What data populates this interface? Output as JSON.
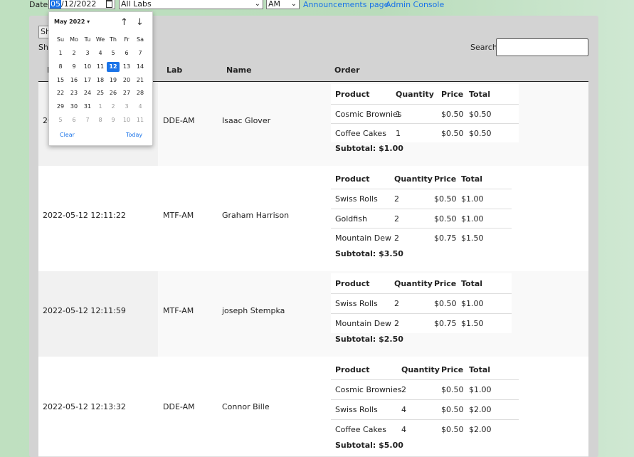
{
  "topbar": {
    "date_label": "Date:",
    "date_month_segment": "05",
    "date_rest": "/12/2022",
    "lab_select": "All Labs",
    "period_select": "AM",
    "links": [
      "Announcements page",
      "Admin Console"
    ]
  },
  "controls": {
    "show_button": "Sh",
    "show_text": "Sho",
    "search_label": "Search:"
  },
  "table": {
    "headers": {
      "date_partial": "I",
      "lab": "Lab",
      "name": "Name",
      "order": "Order"
    },
    "order_headers": [
      "Product",
      "Quantity",
      "Price",
      "Total"
    ],
    "rows": [
      {
        "date": "20",
        "lab": "DDE-AM",
        "name": "Isaac Glover",
        "items": [
          [
            "Cosmic Brownies",
            "1",
            "$0.50",
            "$0.50"
          ],
          [
            "Coffee Cakes",
            "1",
            "$0.50",
            "$0.50"
          ]
        ],
        "subtotal": "Subtotal: $1.00"
      },
      {
        "date": "2022-05-12 12:11:22",
        "lab": "MTF-AM",
        "name": "Graham Harrison",
        "items": [
          [
            "Swiss Rolls",
            "2",
            "$0.50",
            "$1.00"
          ],
          [
            "Goldfish",
            "2",
            "$0.50",
            "$1.00"
          ],
          [
            "Mountain Dew",
            "2",
            "$0.75",
            "$1.50"
          ]
        ],
        "subtotal": "Subtotal: $3.50"
      },
      {
        "date": "2022-05-12 12:11:59",
        "lab": "MTF-AM",
        "name": "joseph Stempka",
        "items": [
          [
            "Swiss Rolls",
            "2",
            "$0.50",
            "$1.00"
          ],
          [
            "Mountain Dew",
            "2",
            "$0.75",
            "$1.50"
          ]
        ],
        "subtotal": "Subtotal: $2.50"
      },
      {
        "date": "2022-05-12 12:13:32",
        "lab": "DDE-AM",
        "name": "Connor Bille",
        "items": [
          [
            "Cosmic Brownies",
            "2",
            "$0.50",
            "$1.00"
          ],
          [
            "Swiss Rolls",
            "4",
            "$0.50",
            "$2.00"
          ],
          [
            "Coffee Cakes",
            "4",
            "$0.50",
            "$2.00"
          ]
        ],
        "subtotal": "Subtotal: $5.00"
      }
    ]
  },
  "calendar": {
    "month_label": "May 2022 ▾",
    "weekdays": [
      "Su",
      "Mo",
      "Tu",
      "We",
      "Th",
      "Fr",
      "Sa"
    ],
    "weeks": [
      [
        "1",
        "2",
        "3",
        "4",
        "5",
        "6",
        "7"
      ],
      [
        "8",
        "9",
        "10",
        "11",
        "12",
        "13",
        "14"
      ],
      [
        "15",
        "16",
        "17",
        "18",
        "19",
        "20",
        "21"
      ],
      [
        "22",
        "23",
        "24",
        "25",
        "26",
        "27",
        "28"
      ],
      [
        "29",
        "30",
        "31",
        "1",
        "2",
        "3",
        "4"
      ],
      [
        "5",
        "6",
        "7",
        "8",
        "9",
        "10",
        "11"
      ]
    ],
    "selected_day": "12",
    "clear_label": "Clear",
    "today_label": "Today"
  },
  "colors": {
    "accent": "#1a73e8",
    "background": "#bfe0c0",
    "panel": "#d3d3d3"
  }
}
